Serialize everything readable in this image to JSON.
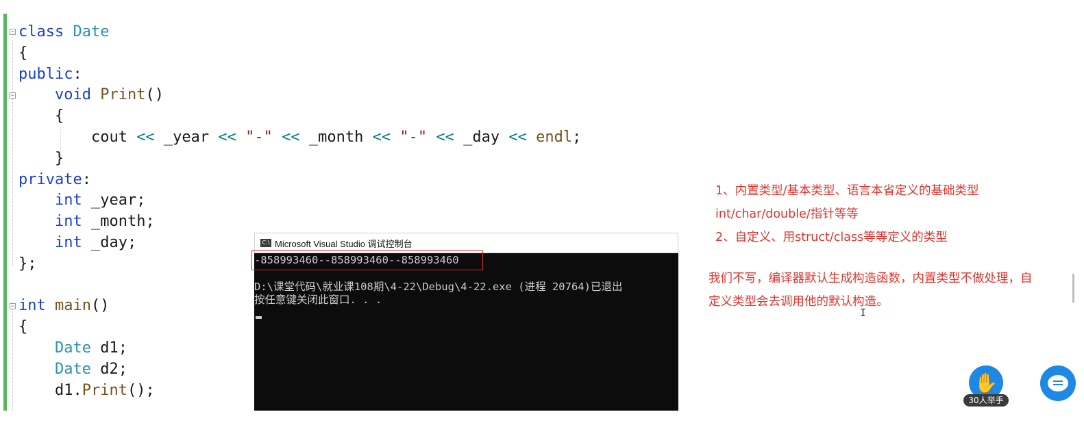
{
  "editor": {
    "lines": [
      [
        {
          "t": "class",
          "c": "kw"
        },
        {
          "t": " "
        },
        {
          "t": "Date",
          "c": "ty"
        }
      ],
      [
        {
          "t": "{"
        }
      ],
      [
        {
          "t": "public",
          "c": "kw"
        },
        {
          "t": ":"
        }
      ],
      [
        {
          "t": "    "
        },
        {
          "t": "void",
          "c": "kw"
        },
        {
          "t": " "
        },
        {
          "t": "Print",
          "c": "fn"
        },
        {
          "t": "()"
        }
      ],
      [
        {
          "t": "    {"
        }
      ],
      [
        {
          "t": "        cout "
        },
        {
          "t": "<<",
          "c": "op"
        },
        {
          "t": " _year "
        },
        {
          "t": "<<",
          "c": "op"
        },
        {
          "t": " "
        },
        {
          "t": "\"-\"",
          "c": "st"
        },
        {
          "t": " "
        },
        {
          "t": "<<",
          "c": "op"
        },
        {
          "t": " _month "
        },
        {
          "t": "<<",
          "c": "op"
        },
        {
          "t": " "
        },
        {
          "t": "\"-\"",
          "c": "st"
        },
        {
          "t": " "
        },
        {
          "t": "<<",
          "c": "op"
        },
        {
          "t": " _day "
        },
        {
          "t": "<<",
          "c": "op"
        },
        {
          "t": " "
        },
        {
          "t": "endl",
          "c": "fn"
        },
        {
          "t": ";"
        }
      ],
      [
        {
          "t": "    }"
        }
      ],
      [
        {
          "t": "private",
          "c": "kw"
        },
        {
          "t": ":"
        }
      ],
      [
        {
          "t": "    "
        },
        {
          "t": "int",
          "c": "kw"
        },
        {
          "t": " _year;"
        }
      ],
      [
        {
          "t": "    "
        },
        {
          "t": "int",
          "c": "kw"
        },
        {
          "t": " _month;"
        }
      ],
      [
        {
          "t": "    "
        },
        {
          "t": "int",
          "c": "kw"
        },
        {
          "t": " _day;"
        }
      ],
      [
        {
          "t": "};"
        }
      ],
      [
        {
          "t": ""
        }
      ],
      [
        {
          "t": "int",
          "c": "kw"
        },
        {
          "t": " "
        },
        {
          "t": "main",
          "c": "fn"
        },
        {
          "t": "()"
        }
      ],
      [
        {
          "t": "{"
        }
      ],
      [
        {
          "t": "    "
        },
        {
          "t": "Date",
          "c": "ty"
        },
        {
          "t": " d1;"
        }
      ],
      [
        {
          "t": "    "
        },
        {
          "t": "Date",
          "c": "ty"
        },
        {
          "t": " d2;"
        }
      ],
      [
        {
          "t": "    d1."
        },
        {
          "t": "Print",
          "c": "fn"
        },
        {
          "t": "();"
        }
      ]
    ]
  },
  "console": {
    "title": "Microsoft Visual Studio 调试控制台",
    "icon": "C:\\",
    "output_line": "-858993460--858993460--858993460",
    "exit_line": "D:\\课堂代码\\就业课108期\\4-22\\Debug\\4-22.exe (进程 20764)已退出",
    "close_prompt": "按任意键关闭此窗口. . ."
  },
  "notes": {
    "line1": "1、内置类型/基本类型、语言本省定义的基础类型",
    "line2": "int/char/double/指针等等",
    "line3": "2、自定义、用struct/class等等定义的类型",
    "line4": "我们不写，编译器默认生成构造函数，内置类型不做处理，自",
    "line5": "定义类型会去调用他的默认构造。",
    "color": "#e0332c"
  },
  "overlay": {
    "raise_hand_label": "30人举手",
    "raise_hand_icon": "raised-hand-icon",
    "chat_icon": "chat-icon"
  }
}
